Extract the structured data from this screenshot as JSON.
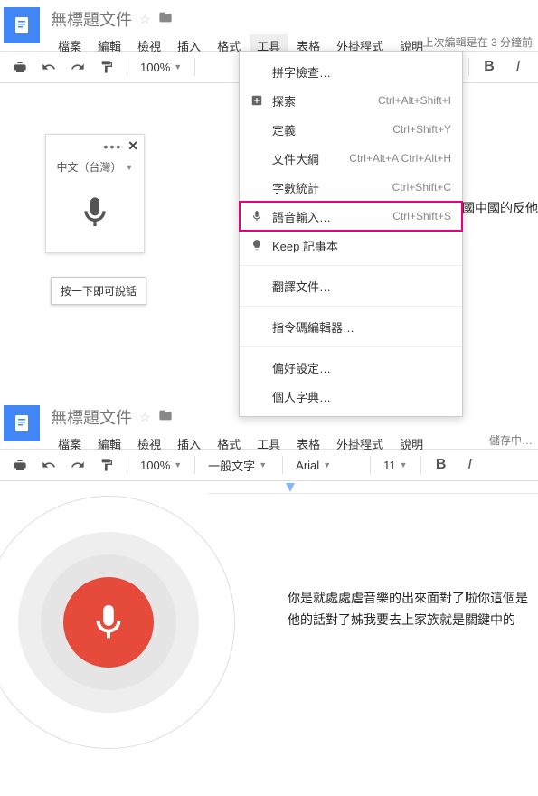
{
  "top": {
    "title": "無標題文件",
    "menus": [
      "檔案",
      "編輯",
      "檢視",
      "插入",
      "格式",
      "工具",
      "表格",
      "外掛程式",
      "說明"
    ],
    "active_menu_index": 5,
    "save_status": "上次編輯是在 3 分鐘前",
    "zoom": "100%",
    "dropdown": [
      {
        "label": "拼字檢查…",
        "shortcut": "",
        "icon": ""
      },
      {
        "label": "探索",
        "shortcut": "Ctrl+Alt+Shift+I",
        "icon": "plus"
      },
      {
        "label": "定義",
        "shortcut": "Ctrl+Shift+Y",
        "icon": ""
      },
      {
        "label": "文件大綱",
        "shortcut": "Ctrl+Alt+A Ctrl+Alt+H",
        "icon": ""
      },
      {
        "label": "字數統計",
        "shortcut": "Ctrl+Shift+C",
        "icon": ""
      },
      {
        "label": "語音輸入…",
        "shortcut": "Ctrl+Shift+S",
        "icon": "mic",
        "highlight": true
      },
      {
        "label": "Keep 記事本",
        "shortcut": "",
        "icon": "bulb"
      },
      {
        "sep": true
      },
      {
        "label": "翻譯文件…",
        "shortcut": "",
        "icon": ""
      },
      {
        "sep": true
      },
      {
        "label": "指令碼編輯器…",
        "shortcut": "",
        "icon": ""
      },
      {
        "sep": true
      },
      {
        "label": "偏好設定…",
        "shortcut": "",
        "icon": ""
      },
      {
        "label": "個人字典…",
        "shortcut": "",
        "icon": ""
      }
    ],
    "voice_panel": {
      "lang": "中文（台灣）",
      "tooltip": "按一下即可說話"
    },
    "doc_fragment": "國中國的反他"
  },
  "bottom": {
    "title": "無標題文件",
    "menus": [
      "檔案",
      "編輯",
      "檢視",
      "插入",
      "格式",
      "工具",
      "表格",
      "外掛程式",
      "說明"
    ],
    "save_status": "儲存中…",
    "zoom": "100%",
    "style": "一般文字",
    "font": "Arial",
    "size": "11",
    "doc_lines": [
      "你是就處處虐音樂的出來面對了啦你這個是",
      "他的話對了姊我要去上家族就是關鍵中的"
    ]
  }
}
